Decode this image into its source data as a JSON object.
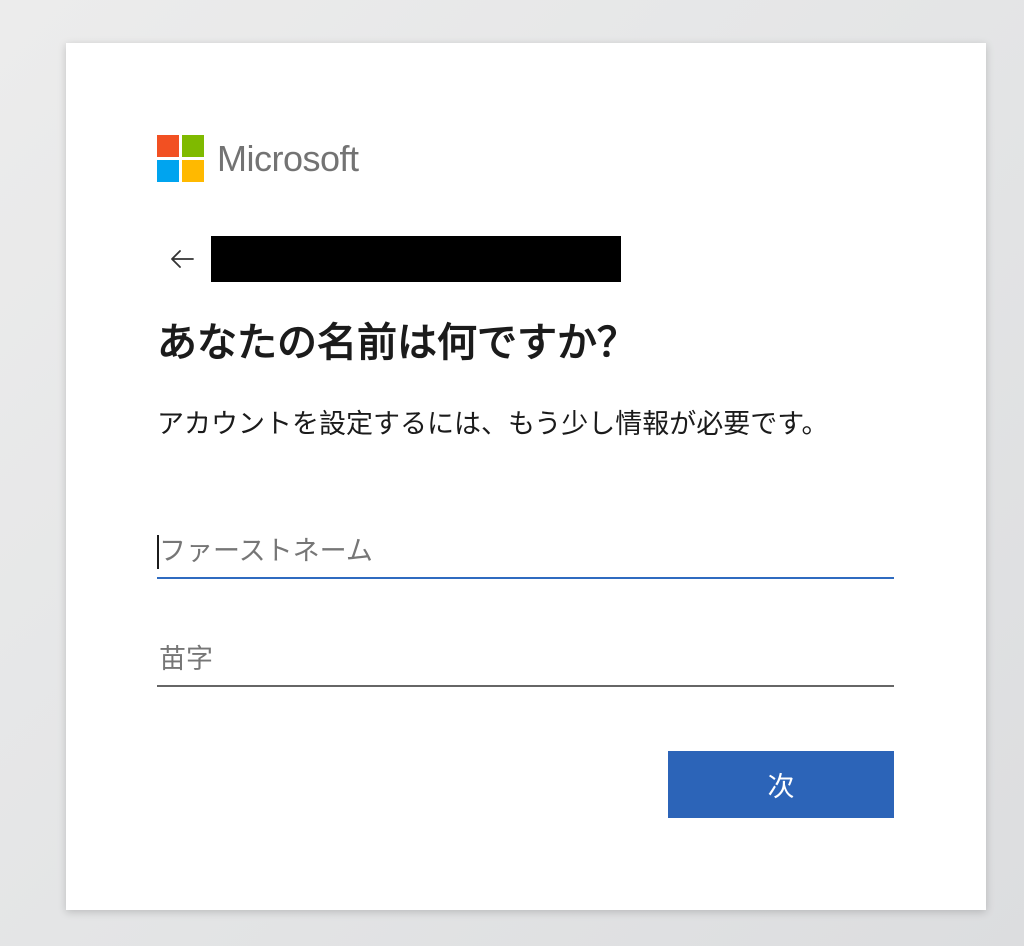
{
  "logo": {
    "text": "Microsoft",
    "colors": [
      "#f25022",
      "#7fba00",
      "#00a4ef",
      "#ffb900"
    ]
  },
  "back": {
    "icon": "back-arrow-icon"
  },
  "heading": "あなたの名前は何ですか？",
  "description": "アカウントを設定するには、もう少し情報が必要です。",
  "form": {
    "first_name": {
      "placeholder": "ファーストネーム",
      "value": ""
    },
    "last_name": {
      "placeholder": "苗字",
      "value": ""
    }
  },
  "next_button": {
    "label": "次"
  },
  "colors": {
    "accent": "#2c64b8",
    "focus_underline": "#2f6bc0"
  }
}
